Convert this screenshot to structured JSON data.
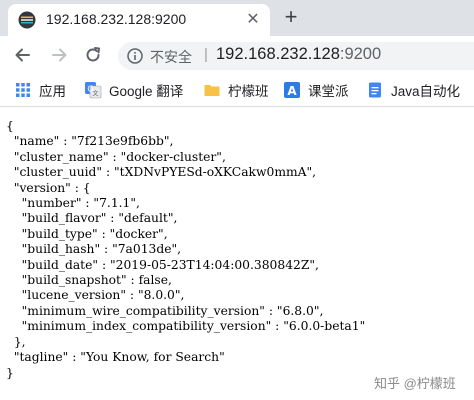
{
  "tab": {
    "title": "192.168.232.128:9200",
    "favicon": "elasticsearch-icon",
    "close_label": "✕",
    "new_tab_label": "+"
  },
  "toolbar": {
    "back_icon": "arrow-left-icon",
    "forward_icon": "arrow-right-icon",
    "reload_icon": "reload-icon"
  },
  "omnibox": {
    "security_text": "不安全",
    "separator": "|",
    "url_host": "192.168.232.128",
    "url_port": ":9200"
  },
  "bookmarks": [
    {
      "label": "应用",
      "icon": "apps-grid-icon"
    },
    {
      "label": "Google 翻译",
      "icon": "google-translate-icon"
    },
    {
      "label": "柠檬班",
      "icon": "folder-icon"
    },
    {
      "label": "课堂派",
      "icon": "ketangpai-icon"
    },
    {
      "label": "Java自动化",
      "icon": "doc-icon"
    }
  ],
  "response_body": "{\n  \"name\" : \"7f213e9fb6bb\",\n  \"cluster_name\" : \"docker-cluster\",\n  \"cluster_uuid\" : \"tXDNvPYESd-oXKCakw0mmA\",\n  \"version\" : {\n    \"number\" : \"7.1.1\",\n    \"build_flavor\" : \"default\",\n    \"build_type\" : \"docker\",\n    \"build_hash\" : \"7a013de\",\n    \"build_date\" : \"2019-05-23T14:04:00.380842Z\",\n    \"build_snapshot\" : false,\n    \"lucene_version\" : \"8.0.0\",\n    \"minimum_wire_compatibility_version\" : \"6.8.0\",\n    \"minimum_index_compatibility_version\" : \"6.0.0-beta1\"\n  },\n  \"tagline\" : \"You Know, for Search\"\n}",
  "watermark": "知乎 @柠檬班"
}
